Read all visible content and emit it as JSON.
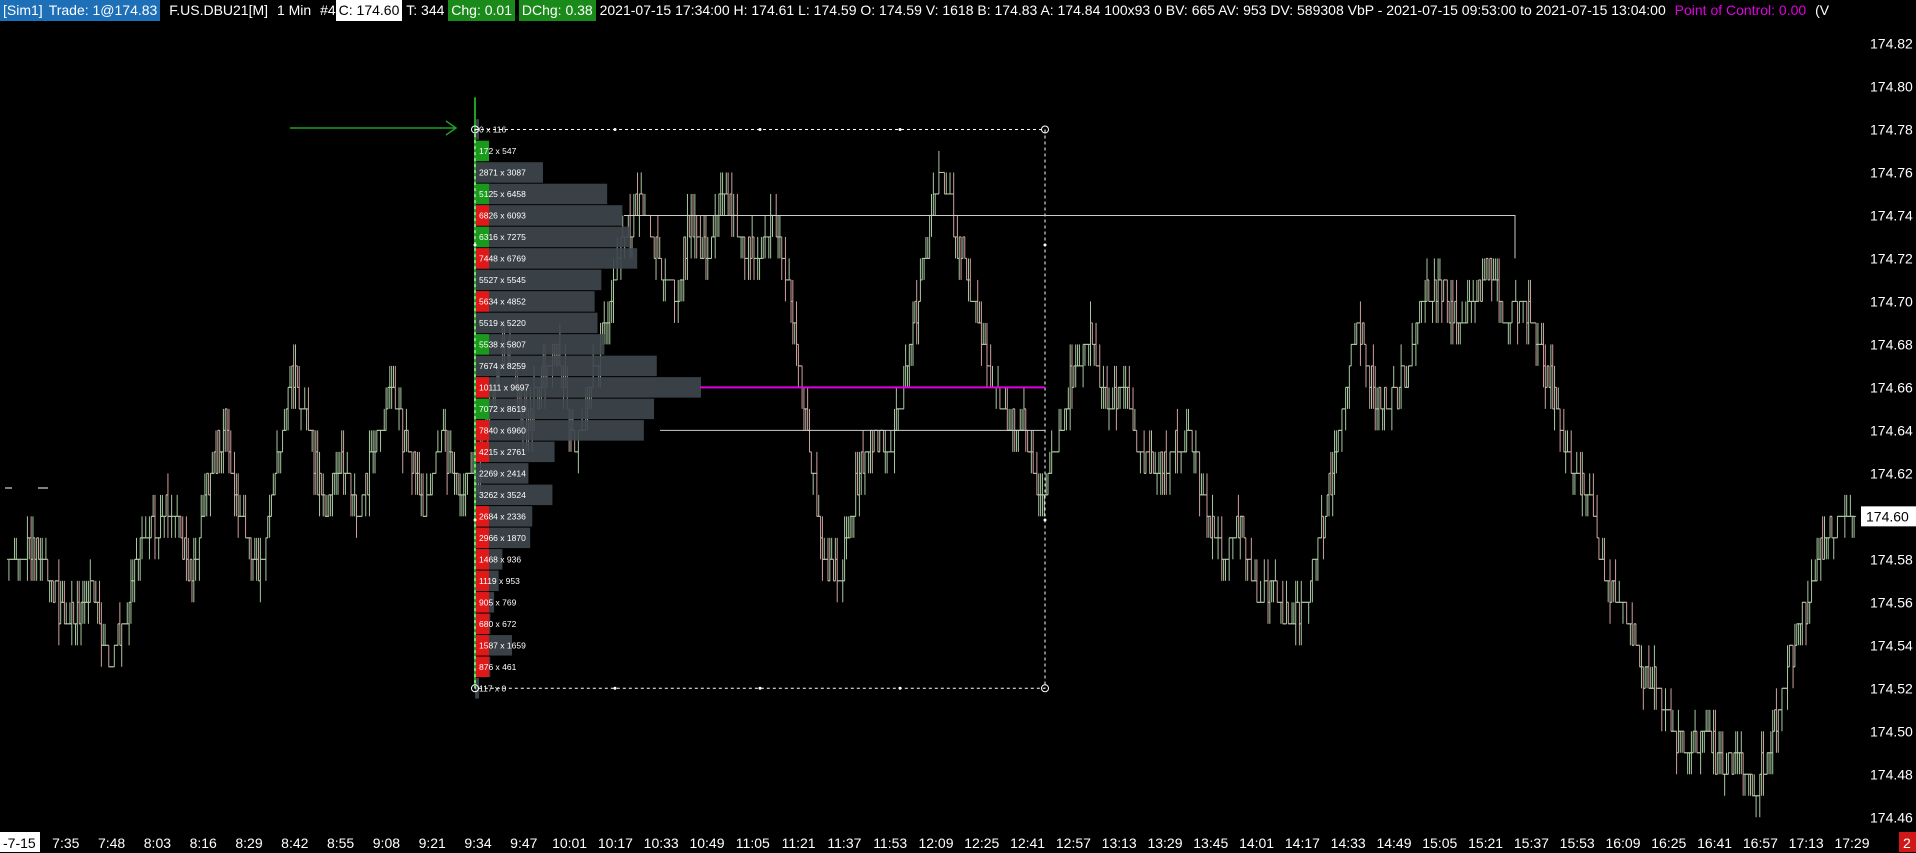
{
  "header": {
    "instance": "[Sim1]",
    "trade": "Trade: 1@174.83",
    "symbol": "F.US.DBU21[M]",
    "timeframe": "1 Min",
    "chart_number": "#4",
    "close_label": "C: 174.60",
    "ticks": "T: 344",
    "chg": "Chg: 0.01",
    "dchg": "DChg: 0.38",
    "stats": "2021-07-15 17:34:00 H: 174.61 L: 174.59 O: 174.59 V: 1618 B: 174.83 A: 174.84 100x93 0 BV: 665 AV: 953 DV: 589308 VbP - 2021-07-15  09:53:00 to 2021-07-15  13:04:00",
    "poc": "Point of Control: 0.00",
    "tail": "(V"
  },
  "colors": {
    "background": "#000000",
    "bar_up": "#a8c8a0",
    "bar_down": "#d0a0a0",
    "profile_bar": "#3e474d",
    "poc_line": "#e000e0",
    "bid_cell": "#e01818",
    "ask_cell": "#1a9a1a",
    "arrow": "#1fa01f"
  },
  "chart_data": {
    "type": "bar",
    "description_type": "ohlc_price_chart_with_volume_profile",
    "y_ticks": [
      "174.82",
      "174.80",
      "174.78",
      "174.76",
      "174.74",
      "174.72",
      "174.70",
      "174.68",
      "174.66",
      "174.64",
      "174.62",
      "174.60",
      "174.58",
      "174.56",
      "174.54",
      "174.52",
      "174.50",
      "174.48",
      "174.46"
    ],
    "ylim": [
      174.455,
      174.83
    ],
    "current_price_label": "174.60",
    "x_ticks": [
      "-7-15",
      "7:35",
      "7:48",
      "8:03",
      "8:16",
      "8:29",
      "8:42",
      "8:55",
      "9:08",
      "9:21",
      "9:34",
      "9:47",
      "10:01",
      "10:17",
      "10:33",
      "10:49",
      "11:05",
      "11:21",
      "11:37",
      "11:53",
      "12:09",
      "12:25",
      "12:41",
      "12:57",
      "13:13",
      "13:29",
      "13:45",
      "14:01",
      "14:17",
      "14:33",
      "14:49",
      "15:05",
      "15:21",
      "15:37",
      "15:53",
      "16:09",
      "16:25",
      "16:41",
      "16:57",
      "17:13",
      "17:29"
    ],
    "corner_badge": "2",
    "price_path": [
      [
        0,
        174.58
      ],
      [
        1,
        174.585
      ],
      [
        2,
        174.58
      ],
      [
        3,
        174.56
      ],
      [
        4,
        174.55
      ],
      [
        5,
        174.57
      ],
      [
        6,
        174.53
      ],
      [
        7,
        174.55
      ],
      [
        8,
        174.59
      ],
      [
        9,
        174.6
      ],
      [
        10,
        174.6
      ],
      [
        11,
        174.57
      ],
      [
        12,
        174.62
      ],
      [
        13,
        174.64
      ],
      [
        14,
        174.6
      ],
      [
        15,
        174.57
      ],
      [
        16,
        174.62
      ],
      [
        17,
        174.67
      ],
      [
        18,
        174.64
      ],
      [
        19,
        174.6
      ],
      [
        20,
        174.63
      ],
      [
        21,
        174.6
      ],
      [
        22,
        174.63
      ],
      [
        23,
        174.66
      ],
      [
        24,
        174.63
      ],
      [
        25,
        174.6
      ],
      [
        26,
        174.64
      ],
      [
        27,
        174.61
      ],
      [
        28,
        174.62
      ],
      [
        29,
        174.66
      ],
      [
        30,
        174.68
      ],
      [
        31,
        174.64
      ],
      [
        32,
        174.66
      ],
      [
        33,
        174.68
      ],
      [
        34,
        174.63
      ],
      [
        35,
        174.66
      ],
      [
        36,
        174.7
      ],
      [
        37,
        174.73
      ],
      [
        38,
        174.75
      ],
      [
        39,
        174.72
      ],
      [
        40,
        174.7
      ],
      [
        41,
        174.74
      ],
      [
        42,
        174.72
      ],
      [
        43,
        174.75
      ],
      [
        44,
        174.73
      ],
      [
        45,
        174.72
      ],
      [
        46,
        174.74
      ],
      [
        47,
        174.7
      ],
      [
        48,
        174.64
      ],
      [
        49,
        174.58
      ],
      [
        50,
        174.57
      ],
      [
        51,
        174.62
      ],
      [
        52,
        174.64
      ],
      [
        53,
        174.63
      ],
      [
        54,
        174.67
      ],
      [
        55,
        174.72
      ],
      [
        56,
        174.76
      ],
      [
        57,
        174.73
      ],
      [
        58,
        174.7
      ],
      [
        59,
        174.66
      ],
      [
        60,
        174.65
      ],
      [
        61,
        174.64
      ],
      [
        62,
        174.61
      ],
      [
        63,
        174.63
      ],
      [
        64,
        174.67
      ],
      [
        65,
        174.69
      ],
      [
        66,
        174.65
      ],
      [
        67,
        174.66
      ],
      [
        68,
        174.63
      ],
      [
        69,
        174.62
      ],
      [
        70,
        174.63
      ],
      [
        71,
        174.64
      ],
      [
        72,
        174.6
      ],
      [
        73,
        174.58
      ],
      [
        74,
        174.6
      ],
      [
        75,
        174.56
      ],
      [
        76,
        174.57
      ],
      [
        77,
        174.55
      ],
      [
        78,
        174.56
      ],
      [
        79,
        174.6
      ],
      [
        80,
        174.64
      ],
      [
        81,
        174.69
      ],
      [
        82,
        174.66
      ],
      [
        83,
        174.65
      ],
      [
        84,
        174.67
      ],
      [
        85,
        174.7
      ],
      [
        86,
        174.71
      ],
      [
        87,
        174.69
      ],
      [
        88,
        174.7
      ],
      [
        89,
        174.72
      ],
      [
        90,
        174.69
      ],
      [
        91,
        174.7
      ],
      [
        92,
        174.68
      ],
      [
        93,
        174.65
      ],
      [
        94,
        174.62
      ],
      [
        95,
        174.61
      ],
      [
        96,
        174.57
      ],
      [
        97,
        174.56
      ],
      [
        98,
        174.53
      ],
      [
        99,
        174.52
      ],
      [
        100,
        174.5
      ],
      [
        101,
        174.49
      ],
      [
        102,
        174.5
      ],
      [
        103,
        174.48
      ],
      [
        104,
        174.49
      ],
      [
        105,
        174.47
      ],
      [
        106,
        174.5
      ],
      [
        107,
        174.53
      ],
      [
        108,
        174.56
      ],
      [
        109,
        174.59
      ],
      [
        110,
        174.6
      ],
      [
        111,
        174.6
      ]
    ],
    "highlight_box": {
      "label_range": "09:53:00 to 13:04:00",
      "price_high": 174.78,
      "price_low": 174.52
    },
    "poc_price": 174.66,
    "value_area_high": 174.74,
    "value_area_low": 174.64,
    "volume_profile": [
      {
        "price": 174.78,
        "label": "0 x 116",
        "volume": 116,
        "side": "none"
      },
      {
        "price": 174.77,
        "label": "172 x 547",
        "volume": 719,
        "side": "ask"
      },
      {
        "price": 174.76,
        "label": "2871 x 3087",
        "volume": 5958,
        "side": "none"
      },
      {
        "price": 174.75,
        "label": "5125 x 6458",
        "volume": 11583,
        "side": "ask"
      },
      {
        "price": 174.74,
        "label": "6826 x 6093",
        "volume": 12919,
        "side": "bid"
      },
      {
        "price": 174.73,
        "label": "6316 x 7275",
        "volume": 13591,
        "side": "ask"
      },
      {
        "price": 174.72,
        "label": "7448 x 6769",
        "volume": 14217,
        "side": "bid"
      },
      {
        "price": 174.71,
        "label": "5527 x 5545",
        "volume": 11072,
        "side": "none"
      },
      {
        "price": 174.7,
        "label": "5634 x 4852",
        "volume": 10486,
        "side": "bid"
      },
      {
        "price": 174.69,
        "label": "5519 x 5220",
        "volume": 10739,
        "side": "none"
      },
      {
        "price": 174.68,
        "label": "5538 x 5807",
        "volume": 11345,
        "side": "ask"
      },
      {
        "price": 174.67,
        "label": "7674 x 8259",
        "volume": 15933,
        "side": "none"
      },
      {
        "price": 174.66,
        "label": "10111 x 9697",
        "volume": 19808,
        "side": "bid"
      },
      {
        "price": 174.65,
        "label": "7072 x 8619",
        "volume": 15691,
        "side": "ask"
      },
      {
        "price": 174.64,
        "label": "7840 x 6960",
        "volume": 14800,
        "side": "bid"
      },
      {
        "price": 174.63,
        "label": "4215 x 2761",
        "volume": 6976,
        "side": "bid"
      },
      {
        "price": 174.62,
        "label": "2269 x 2414",
        "volume": 4683,
        "side": "none"
      },
      {
        "price": 174.61,
        "label": "3262 x 3524",
        "volume": 6786,
        "side": "none"
      },
      {
        "price": 174.6,
        "label": "2684 x 2336",
        "volume": 5020,
        "side": "bid"
      },
      {
        "price": 174.59,
        "label": "2966 x 1870",
        "volume": 4836,
        "side": "bid"
      },
      {
        "price": 174.58,
        "label": "1468 x 936",
        "volume": 2404,
        "side": "bid"
      },
      {
        "price": 174.57,
        "label": "1119 x 953",
        "volume": 2072,
        "side": "bid"
      },
      {
        "price": 174.56,
        "label": "905 x 769",
        "volume": 1674,
        "side": "bid"
      },
      {
        "price": 174.55,
        "label": "680 x 672",
        "volume": 1352,
        "side": "bid"
      },
      {
        "price": 174.54,
        "label": "1587 x 1659",
        "volume": 3246,
        "side": "bid"
      },
      {
        "price": 174.53,
        "label": "876 x 461",
        "volume": 1337,
        "side": "bid"
      },
      {
        "price": 174.52,
        "label": "117 x 0",
        "volume": 117,
        "side": "none"
      }
    ]
  }
}
